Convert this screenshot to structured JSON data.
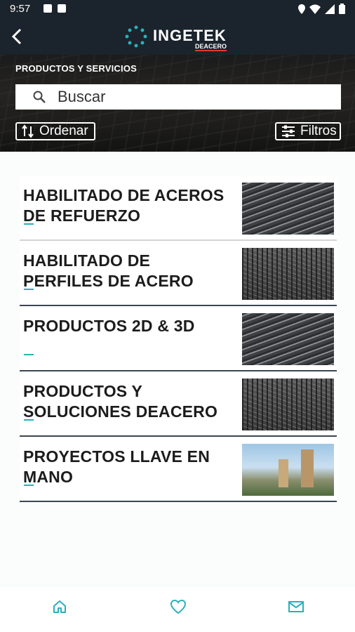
{
  "status": {
    "time": "9:57"
  },
  "header": {
    "brand": "INGETEK",
    "brand_sub": "DEACERO"
  },
  "hero": {
    "title": "PRODUCTOS Y SERVICIOS",
    "search_placeholder": "Buscar",
    "sort_label": "Ordenar",
    "filter_label": "Filtros"
  },
  "items": [
    {
      "label": "HABILITADO DE ACEROS DE REFUERZO",
      "thumb": "rebar-bundles"
    },
    {
      "label": "HABILITADO DE PERFILES DE ACERO",
      "thumb": "steel-mesh"
    },
    {
      "label": "PRODUCTOS 2D & 3D",
      "thumb": "rebar-bundles"
    },
    {
      "label": "PRODUCTOS Y SOLUCIONES DEACERO",
      "thumb": "steel-mesh"
    },
    {
      "label": "PROYECTOS LLAVE EN MANO",
      "thumb": "city-towers"
    }
  ],
  "bottom_nav": {
    "items": [
      "home-icon",
      "heart-icon",
      "mail-icon"
    ],
    "accent": "#2bb0ba"
  },
  "colors": {
    "header_bg": "#1b232c",
    "accent": "#2bb0ba",
    "divider": "#3b4650"
  }
}
